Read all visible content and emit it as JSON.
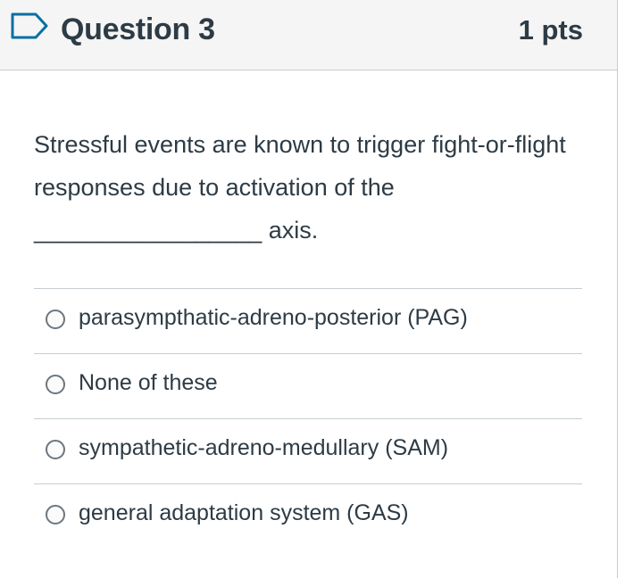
{
  "question": {
    "title": "Question 3",
    "points": "1 pts",
    "flag_icon": "flag-outline-icon",
    "text": "Stressful events are known to trigger fight-or-flight responses due to activation of the _________________ axis."
  },
  "answers": [
    {
      "label": "parasympthatic-adreno-posterior (PAG)",
      "selected": false
    },
    {
      "label": "None of these",
      "selected": false
    },
    {
      "label": "sympathetic-adreno-medullary (SAM)",
      "selected": false
    },
    {
      "label": "general adaptation system (GAS)",
      "selected": false
    }
  ],
  "colors": {
    "header_bg": "#f5f5f5",
    "text": "#2d3b45",
    "divider": "#c7cdd1",
    "flag": "#0770a3"
  }
}
